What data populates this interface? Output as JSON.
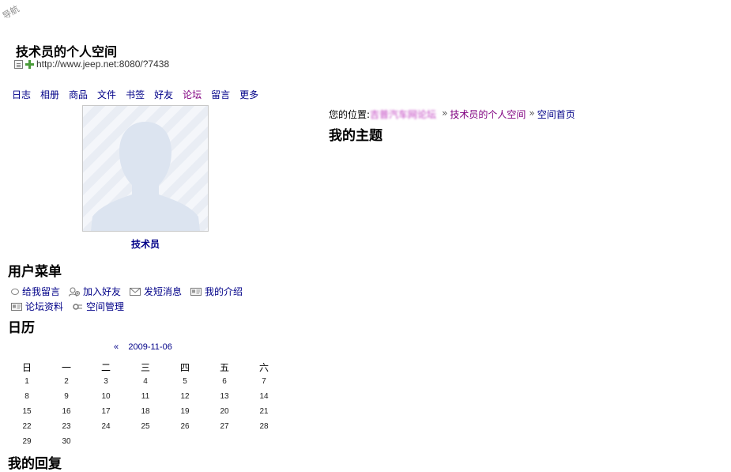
{
  "nav_badge": "导航",
  "space": {
    "title": "技术员的个人空间",
    "url": "http://www.jeep.net:8080/?7438"
  },
  "top_menu": [
    "日志",
    "相册",
    "商品",
    "文件",
    "书签",
    "好友",
    "论坛",
    "留言",
    "更多"
  ],
  "profile": {
    "name": "技术员"
  },
  "user_menu": {
    "title": "用户菜单",
    "row1": [
      {
        "label": "给我留言",
        "icon": "comment-bubble-icon"
      },
      {
        "label": "加入好友",
        "icon": "add-friend-icon"
      },
      {
        "label": "发短消息",
        "icon": "envelope-icon"
      },
      {
        "label": "我的介绍",
        "icon": "id-card-icon"
      }
    ],
    "row2": [
      {
        "label": "论坛资料",
        "icon": "profile-card-icon"
      },
      {
        "label": "空间管理",
        "icon": "settings-icon"
      }
    ]
  },
  "calendar": {
    "title": "日历",
    "prev": "«",
    "date": "2009-11-06",
    "weekdays": [
      "日",
      "一",
      "二",
      "三",
      "四",
      "五",
      "六"
    ],
    "weeks": [
      [
        "1",
        "2",
        "3",
        "4",
        "5",
        "6",
        "7"
      ],
      [
        "8",
        "9",
        "10",
        "11",
        "12",
        "13",
        "14"
      ],
      [
        "15",
        "16",
        "17",
        "18",
        "19",
        "20",
        "21"
      ],
      [
        "22",
        "23",
        "24",
        "25",
        "26",
        "27",
        "28"
      ],
      [
        "29",
        "30",
        "",
        "",
        "",
        "",
        ""
      ]
    ]
  },
  "reply_title": "我的回复",
  "breadcrumb": {
    "label": "您的位置:",
    "blurred": "吉普汽车网论坛",
    "sep": "»",
    "space_link": "技术员的个人空间",
    "current": "空间首页"
  },
  "topics_title": "我的主题",
  "colors": {
    "link": "#000088",
    "visited": "#800080"
  }
}
